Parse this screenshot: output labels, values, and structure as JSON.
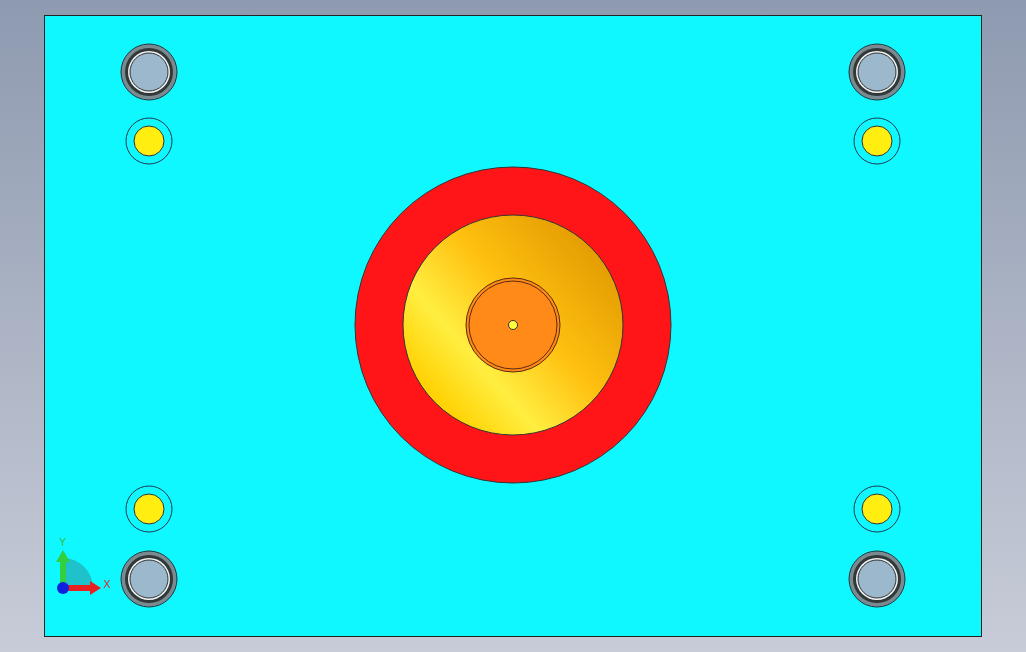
{
  "triad": {
    "x_label": "X",
    "y_label": "Y"
  }
}
